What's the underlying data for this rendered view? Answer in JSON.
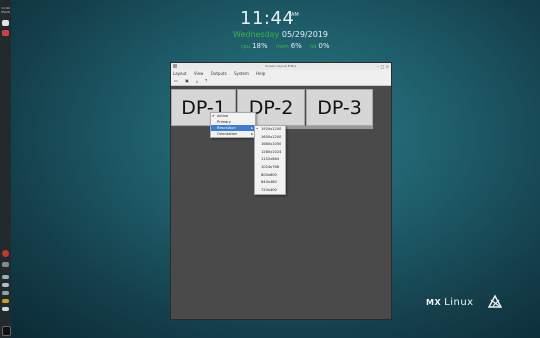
{
  "panel": {
    "clock_line1": "11:44",
    "clock_line2": "05/29"
  },
  "conky": {
    "time": "11:44",
    "ampm": "AM",
    "day": "Wednesday",
    "date": "05/29/2019",
    "stats": [
      {
        "label": "cpu",
        "value": "18%"
      },
      {
        "label": "mem",
        "value": "6%"
      },
      {
        "label": "hd",
        "value": "0%"
      }
    ]
  },
  "window": {
    "title": "Screen Layout Editor",
    "menubar": [
      "Layout",
      "View",
      "Outputs",
      "System",
      "Help"
    ],
    "toolbar_icons": [
      "folder-icon",
      "save-icon",
      "download-icon",
      "upload-icon"
    ],
    "outputs": [
      "DP-1",
      "DP-2",
      "DP-3"
    ]
  },
  "context_menu": {
    "items": [
      {
        "label": "Active",
        "checked": true
      },
      {
        "label": "Primary",
        "checked": false
      },
      {
        "label": "Resolution",
        "has_submenu": true,
        "highlighted": true
      },
      {
        "label": "Orientation",
        "has_submenu": true
      }
    ]
  },
  "resolution_menu": {
    "items": [
      "1920x1200",
      "1600x1200",
      "1680x1050",
      "1280x1024",
      "1152x864",
      "1024x768",
      "800x600",
      "640x480",
      "720x400"
    ],
    "selected": "1920x1200"
  },
  "logo": {
    "brand": "MX",
    "text": "Linux"
  }
}
